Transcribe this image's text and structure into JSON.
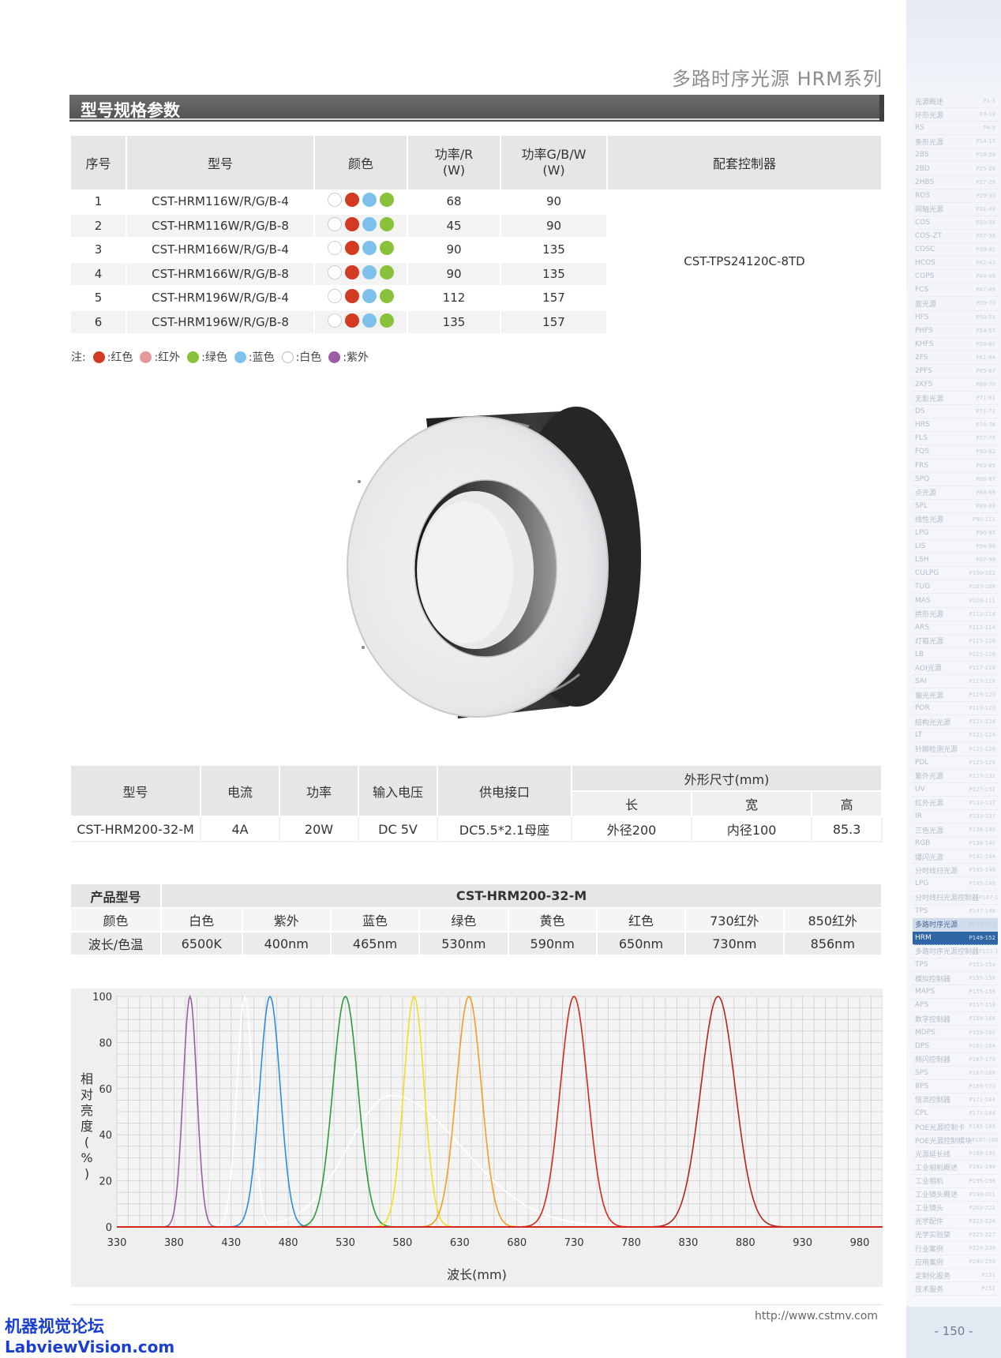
{
  "header": {
    "series_title": "多路时序光源 HRM系列",
    "section_title": "型号规格参数"
  },
  "spec_table": {
    "headers": [
      "序号",
      "型号",
      "颜色",
      "功率/R (W)",
      "功率G/B/W (W)",
      "配套控制器"
    ],
    "controller": "CST-TPS24120C-8TD",
    "rows": [
      {
        "no": "1",
        "model": "CST-HRM116W/R/G/B-4",
        "power_r": "68",
        "power_gbw": "90"
      },
      {
        "no": "2",
        "model": "CST-HRM116W/R/G/B-8",
        "power_r": "45",
        "power_gbw": "90"
      },
      {
        "no": "3",
        "model": "CST-HRM166W/R/G/B-4",
        "power_r": "90",
        "power_gbw": "135"
      },
      {
        "no": "4",
        "model": "CST-HRM166W/R/G/B-8",
        "power_r": "90",
        "power_gbw": "135"
      },
      {
        "no": "5",
        "model": "CST-HRM196W/R/G/B-4",
        "power_r": "112",
        "power_gbw": "157"
      },
      {
        "no": "6",
        "model": "CST-HRM196W/R/G/B-8",
        "power_r": "135",
        "power_gbw": "157"
      }
    ],
    "color_dots": [
      "#ffffff",
      "#d23a22",
      "#7ec1ea",
      "#88c23a"
    ]
  },
  "legend": {
    "prefix": "注:",
    "items": [
      {
        "color": "#d23a22",
        "label": ":红色"
      },
      {
        "color": "#e59a9a",
        "label": ":红外"
      },
      {
        "color": "#88c23a",
        "label": ":绿色"
      },
      {
        "color": "#7ec1ea",
        "label": ":蓝色"
      },
      {
        "color": "#ffffff",
        "label": ":白色"
      },
      {
        "color": "#9b5ea6",
        "label": ":紫外"
      }
    ]
  },
  "elec_table": {
    "headers": {
      "model": "型号",
      "current": "电流",
      "power": "功率",
      "voltage": "输入电压",
      "port": "供电接口",
      "dims": "外形尺寸(mm)",
      "len": "长",
      "wid": "宽",
      "hei": "高"
    },
    "row": {
      "model": "CST-HRM200-32-M",
      "current": "4A",
      "power": "20W",
      "voltage": "DC 5V",
      "port": "DC5.5*2.1母座",
      "len": "外径200",
      "wid": "内径100",
      "hei": "85.3"
    }
  },
  "wave_table": {
    "product_label": "产品型号",
    "product_model": "CST-HRM200-32-M",
    "color_label": "颜色",
    "wave_label": "波长/色温",
    "colors": [
      "白色",
      "紫外",
      "蓝色",
      "绿色",
      "黄色",
      "红色",
      "730红外",
      "850红外"
    ],
    "waves": [
      "6500K",
      "400nm",
      "465nm",
      "530nm",
      "590nm",
      "650nm",
      "730nm",
      "856nm"
    ]
  },
  "chart_data": {
    "type": "line",
    "xlabel": "波长(mm)",
    "ylabel": "相对亮度(%)",
    "xlim": [
      330,
      1000
    ],
    "ylim": [
      0,
      100
    ],
    "xticks": [
      330,
      380,
      430,
      480,
      530,
      580,
      630,
      680,
      730,
      780,
      830,
      880,
      930,
      980
    ],
    "yticks": [
      0,
      20,
      40,
      60,
      80,
      100
    ],
    "grid": true,
    "series": [
      {
        "color": "#9b5ea6",
        "peak": 394,
        "width": 6
      },
      {
        "color": "#ffffff",
        "peak": 442,
        "width": 7,
        "broad_peak": 570,
        "broad_value": 57
      },
      {
        "color": "#2a8fd8",
        "peak": 464,
        "width": 9
      },
      {
        "color": "#2e9a3a",
        "peak": 530,
        "width": 11
      },
      {
        "color": "#f0e020",
        "peak": 590,
        "width": 9
      },
      {
        "color": "#f0a020",
        "peak": 638,
        "width": 11
      },
      {
        "color": "#d02a1a",
        "peak": 730,
        "width": 12
      },
      {
        "color": "#b0281a",
        "peak": 856,
        "width": 15
      }
    ]
  },
  "sidebar": {
    "items": [
      {
        "label": "光源概述",
        "page": "P1-3"
      },
      {
        "label": "环形光源",
        "page": "P4-19"
      },
      {
        "label": "RS",
        "page": "P4-9"
      },
      {
        "label": "条形光源",
        "page": "P14-17"
      },
      {
        "label": "2BS",
        "page": "P18-24"
      },
      {
        "label": "2BD",
        "page": "P25-26"
      },
      {
        "label": "2HBS",
        "page": "P27-29"
      },
      {
        "label": "ROS",
        "page": "P29-30"
      },
      {
        "label": "同轴光源",
        "page": "P31-49"
      },
      {
        "label": "COS",
        "page": "P33-36"
      },
      {
        "label": "COS-ZT",
        "page": "P37-38"
      },
      {
        "label": "COSC",
        "page": "P39-41"
      },
      {
        "label": "HCOS",
        "page": "P42-43"
      },
      {
        "label": "COPS",
        "page": "P44-46"
      },
      {
        "label": "FCS",
        "page": "P47-49"
      },
      {
        "label": "面光源",
        "page": "P50-70"
      },
      {
        "label": "HFS",
        "page": "P50-53"
      },
      {
        "label": "PHFS",
        "page": "P54-57"
      },
      {
        "label": "KHFS",
        "page": "P58-60"
      },
      {
        "label": "2FS",
        "page": "P61-64"
      },
      {
        "label": "2PFS",
        "page": "P65-67"
      },
      {
        "label": "2KFS",
        "page": "P68-70"
      },
      {
        "label": "无影光源",
        "page": "P71-81"
      },
      {
        "label": "DS",
        "page": "P71-73"
      },
      {
        "label": "HRS",
        "page": "P74-76"
      },
      {
        "label": "FLS",
        "page": "P77-79"
      },
      {
        "label": "FQS",
        "page": "P80-82"
      },
      {
        "label": "FRS",
        "page": "P83-85"
      },
      {
        "label": "SPQ",
        "page": "P86-87"
      },
      {
        "label": "点光源",
        "page": "P88-89"
      },
      {
        "label": "SPL",
        "page": "P88-89"
      },
      {
        "label": "线性光源",
        "page": "P90-111"
      },
      {
        "label": "LPG",
        "page": "P90-93"
      },
      {
        "label": "LIS",
        "page": "P94-96"
      },
      {
        "label": "LSH",
        "page": "P97-99"
      },
      {
        "label": "CULPG",
        "page": "P100-102"
      },
      {
        "label": "TUG",
        "page": "P103-108"
      },
      {
        "label": "MAS",
        "page": "P109-111"
      },
      {
        "label": "拱形光源",
        "page": "P112-114"
      },
      {
        "label": "ARS",
        "page": "P112-114"
      },
      {
        "label": "灯箱光源",
        "page": "P115-116"
      },
      {
        "label": "LB",
        "page": "P115-116"
      },
      {
        "label": "AOI光源",
        "page": "P117-118"
      },
      {
        "label": "SAI",
        "page": "P117-118"
      },
      {
        "label": "偏光光源",
        "page": "P119-120"
      },
      {
        "label": "POR",
        "page": "P119-120"
      },
      {
        "label": "结构光光源",
        "page": "P121-124"
      },
      {
        "label": "LT",
        "page": "P121-124"
      },
      {
        "label": "针脚检测光源",
        "page": "P125-126"
      },
      {
        "label": "PDL",
        "page": "P125-126"
      },
      {
        "label": "紫外光源",
        "page": "P127-132"
      },
      {
        "label": "UV",
        "page": "P127-132"
      },
      {
        "label": "红外光源",
        "page": "P133-137"
      },
      {
        "label": "IR",
        "page": "P133-137"
      },
      {
        "label": "三色光源",
        "page": "P138-140"
      },
      {
        "label": "RGB",
        "page": "P138-140"
      },
      {
        "label": "爆闪光源",
        "page": "P141-144"
      },
      {
        "label": "分时线扫光源",
        "page": "P145-146"
      },
      {
        "label": "LPG",
        "page": "P145-146"
      },
      {
        "label": "分时线扫光源控制器",
        "page": "P147-148"
      },
      {
        "label": "TPS",
        "page": "P147-148"
      },
      {
        "label": "多路时序光源",
        "page": "P149-152",
        "state": "hl"
      },
      {
        "label": "HRM",
        "page": "P149-152",
        "state": "active"
      },
      {
        "label": "多路时序光源控制器",
        "page": "P153-154"
      },
      {
        "label": "TPS",
        "page": "P153-154"
      },
      {
        "label": "模拟控制器",
        "page": "P155-158"
      },
      {
        "label": "MAPS",
        "page": "P155-156"
      },
      {
        "label": "APS",
        "page": "P157-158"
      },
      {
        "label": "数字控制器",
        "page": "P159-166"
      },
      {
        "label": "MDPS",
        "page": "P159-160"
      },
      {
        "label": "DPS",
        "page": "P161-164"
      },
      {
        "label": "频闪控制器",
        "page": "P167-170"
      },
      {
        "label": "SPS",
        "page": "P167-168"
      },
      {
        "label": "BPS",
        "page": "P169-170"
      },
      {
        "label": "恒流控制器",
        "page": "P171-184"
      },
      {
        "label": "CPL",
        "page": "P171-184"
      },
      {
        "label": "POE光源控制卡",
        "page": "P185-186"
      },
      {
        "label": "POE光源控制模块",
        "page": "P187-188"
      },
      {
        "label": "光源延长线",
        "page": "P189-190"
      },
      {
        "label": "工业相机概述",
        "page": "P191-194"
      },
      {
        "label": "工业相机",
        "page": "P195-198"
      },
      {
        "label": "工业镜头概述",
        "page": "P199-201"
      },
      {
        "label": "工业镜头",
        "page": "P202-222"
      },
      {
        "label": "光学配件",
        "page": "P223-224"
      },
      {
        "label": "光学实验架",
        "page": "P225-227"
      },
      {
        "label": "行业案例",
        "page": "P228-239"
      },
      {
        "label": "应用案例",
        "page": "P240-250"
      },
      {
        "label": "定制化服务",
        "page": "P251"
      },
      {
        "label": "技术服务",
        "page": "P252"
      }
    ]
  },
  "footer": {
    "url": "http://www.cstmv.com",
    "page_number": "- 150 -",
    "watermark_cn": "机器视觉论坛",
    "watermark_en": "LabviewVision.com"
  }
}
